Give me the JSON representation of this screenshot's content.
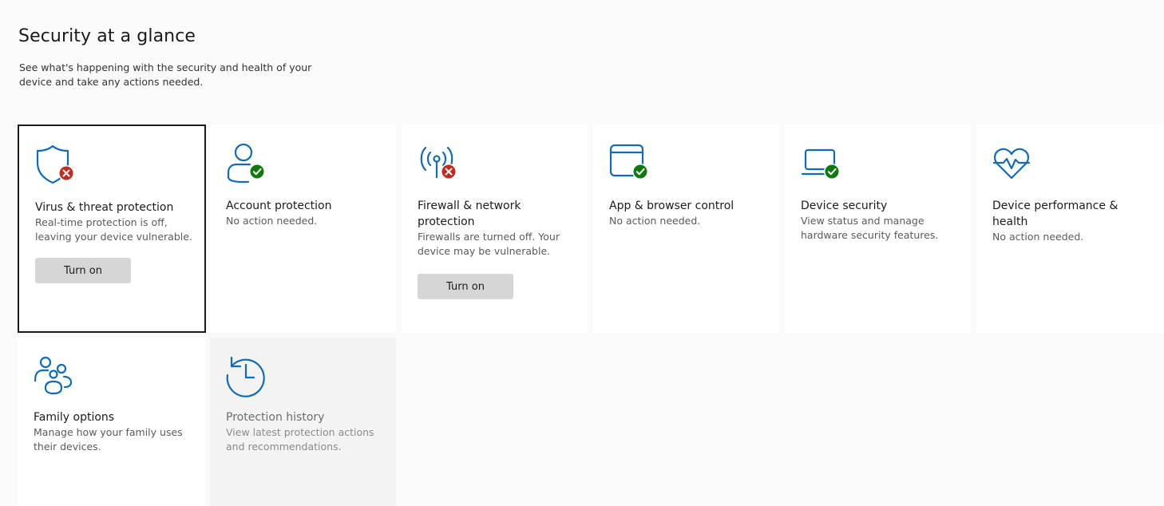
{
  "header": {
    "title": "Security at a glance",
    "subtitle": "See what's happening with the security and health of your device and take any actions needed."
  },
  "colors": {
    "accent": "#0f6cbd",
    "ok": "#0e7a0d",
    "error": "#c42b1c"
  },
  "tiles": [
    {
      "title": "Virus & threat protection",
      "desc": "Real-time protection is off, leaving your device vulnerable.",
      "icon": "shield-icon",
      "status": "error",
      "button": "Turn on"
    },
    {
      "title": "Account protection",
      "desc": "No action needed.",
      "icon": "person-icon",
      "status": "ok"
    },
    {
      "title": "Firewall & network protection",
      "desc": "Firewalls are turned off. Your device may be vulnerable.",
      "icon": "antenna-icon",
      "status": "error",
      "button": "Turn on"
    },
    {
      "title": "App & browser control",
      "desc": "No action needed.",
      "icon": "browser-window-icon",
      "status": "ok"
    },
    {
      "title": "Device security",
      "desc": "View status and manage hardware security features.",
      "icon": "laptop-icon",
      "status": "ok"
    },
    {
      "title": "Device performance & health",
      "desc": "No action needed.",
      "icon": "heart-pulse-icon",
      "status": "none"
    },
    {
      "title": "Family options",
      "desc": "Manage how your family uses their devices.",
      "icon": "family-icon",
      "status": "none"
    },
    {
      "title": "Protection history",
      "desc": "View latest protection actions and recommendations.",
      "icon": "history-clock-icon",
      "status": "none"
    }
  ]
}
